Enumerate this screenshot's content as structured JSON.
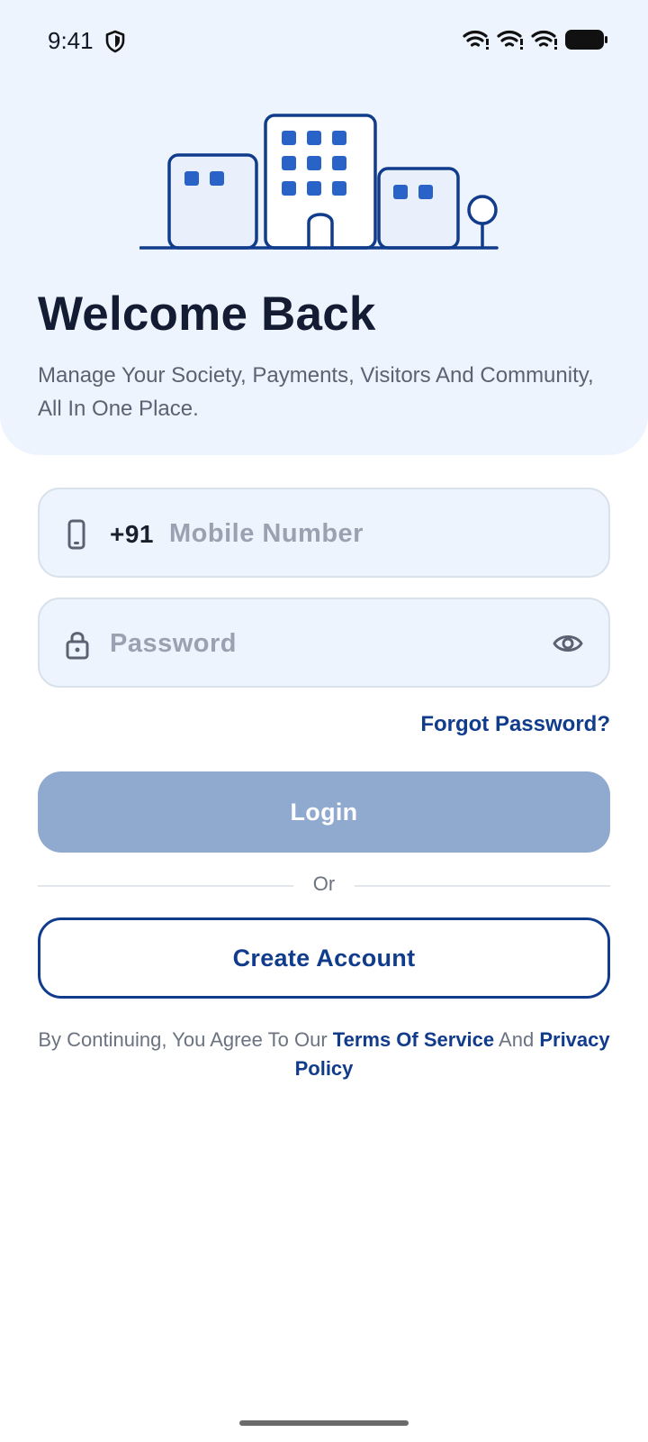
{
  "status_bar": {
    "time": "9:41",
    "icons": [
      "shield-icon",
      "wifi-icon",
      "wifi-icon",
      "wifi-icon",
      "battery-icon"
    ]
  },
  "header": {
    "illustration": "buildings-illustration",
    "title": "Welcome Back",
    "subtitle": "Manage Your Society, Payments, Visitors And Community, All In One Place."
  },
  "form": {
    "phone": {
      "icon": "phone-icon",
      "country_code": "+91",
      "placeholder": "Mobile Number",
      "value": ""
    },
    "password": {
      "icon": "lock-icon",
      "placeholder": "Password",
      "value": "",
      "toggle_icon": "eye-icon"
    },
    "forgot_label": "Forgot Password?",
    "login_label": "Login",
    "divider_label": "Or",
    "create_label": "Create Account"
  },
  "legal": {
    "prefix": "By Continuing, You Agree To Our",
    "terms": "Terms Of Service",
    "middle": "And",
    "privacy": "Privacy Policy"
  },
  "colors": {
    "primary": "#113c8c",
    "login_disabled": "#90a9cf",
    "hero_bg": "#eef4fd",
    "field_bg": "#eef4fd",
    "window_blue": "#2a63c8"
  }
}
